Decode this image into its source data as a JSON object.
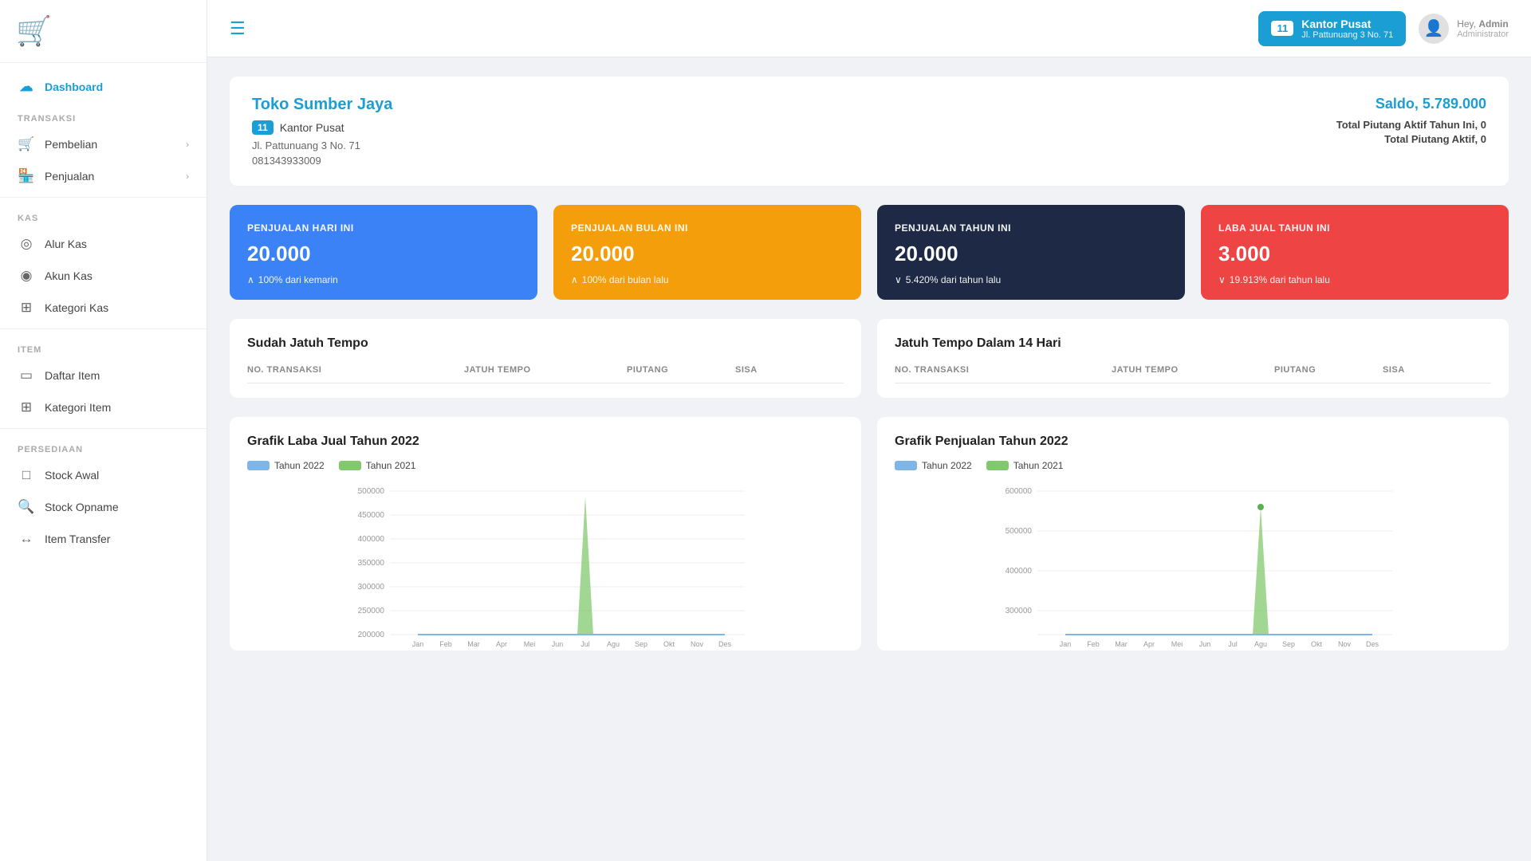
{
  "sidebar": {
    "logo_icon": "🛒",
    "nav_items": [
      {
        "id": "dashboard",
        "label": "Dashboard",
        "icon": "☁",
        "active": true,
        "section": null
      },
      {
        "id": "pembelian",
        "label": "Pembelian",
        "icon": "🛒",
        "active": false,
        "section": "TRANSAKSI",
        "has_chevron": true
      },
      {
        "id": "penjualan",
        "label": "Penjualan",
        "icon": "🏪",
        "active": false,
        "section": null,
        "has_chevron": true
      },
      {
        "id": "alur-kas",
        "label": "Alur Kas",
        "icon": "◎",
        "active": false,
        "section": "KAS"
      },
      {
        "id": "akun-kas",
        "label": "Akun Kas",
        "icon": "◉",
        "active": false,
        "section": null
      },
      {
        "id": "kategori-kas",
        "label": "Kategori Kas",
        "icon": "⊞",
        "active": false,
        "section": null
      },
      {
        "id": "daftar-item",
        "label": "Daftar Item",
        "icon": "▭",
        "active": false,
        "section": "ITEM"
      },
      {
        "id": "kategori-item",
        "label": "Kategori Item",
        "icon": "⊞",
        "active": false,
        "section": null
      },
      {
        "id": "stock-awal",
        "label": "Stock Awal",
        "icon": "□",
        "active": false,
        "section": "PERSEDIAAN"
      },
      {
        "id": "stock-opname",
        "label": "Stock Opname",
        "icon": "🔍",
        "active": false,
        "section": null
      },
      {
        "id": "item-transfer",
        "label": "Item Transfer",
        "icon": "↔",
        "active": false,
        "section": null
      }
    ]
  },
  "topbar": {
    "store_num": "11",
    "store_name": "Kantor Pusat",
    "store_addr": "Jl. Pattunuang 3 No. 71",
    "user_hey": "Hey,",
    "user_name": "Admin",
    "user_role": "Administrator"
  },
  "store_card": {
    "name": "Toko Sumber Jaya",
    "branch_num": "11",
    "branch_name": "Kantor Pusat",
    "address": "Jl. Pattunuang 3 No. 71",
    "phone": "081343933009",
    "saldo": "Saldo, 5.789.000",
    "piutang_aktif_tahun": "Total Piutang Aktif Tahun Ini,",
    "piutang_aktif_tahun_val": "0",
    "piutang_aktif": "Total Piutang Aktif,",
    "piutang_aktif_val": "0"
  },
  "stats": [
    {
      "label": "PENJUALAN HARI INI",
      "value": "20.000",
      "change": "100% dari kemarin",
      "direction": "up",
      "color": "blue"
    },
    {
      "label": "PENJUALAN BULAN INI",
      "value": "20.000",
      "change": "100% dari bulan lalu",
      "direction": "up",
      "color": "orange"
    },
    {
      "label": "PENJUALAN TAHUN INI",
      "value": "20.000",
      "change": "5.420% dari tahun lalu",
      "direction": "down",
      "color": "dark"
    },
    {
      "label": "LABA JUAL TAHUN INI",
      "value": "3.000",
      "change": "19.913% dari tahun lalu",
      "direction": "down",
      "color": "red"
    }
  ],
  "jatuh_tempo_left": {
    "title": "Sudah Jatuh Tempo",
    "columns": [
      "NO. TRANSAKSI",
      "JATUH TEMPO",
      "PIUTANG",
      "SISA"
    ],
    "rows": []
  },
  "jatuh_tempo_right": {
    "title": "Jatuh Tempo Dalam 14 Hari",
    "columns": [
      "NO. TRANSAKSI",
      "JATUH TEMPO",
      "PIUTANG",
      "SISA"
    ],
    "rows": []
  },
  "chart_left": {
    "title": "Grafik Laba Jual Tahun 2022",
    "legend": [
      {
        "label": "Tahun 2022",
        "color": "#7eb6e8"
      },
      {
        "label": "Tahun 2021",
        "color": "#82c96e"
      }
    ],
    "y_labels": [
      "500000",
      "450000",
      "400000",
      "350000",
      "300000",
      "250000",
      "200000"
    ],
    "data_2022": [
      0,
      0,
      0,
      0,
      0,
      0,
      480000,
      0,
      0,
      0,
      0,
      0
    ],
    "data_2021": [
      0,
      0,
      0,
      0,
      0,
      0,
      0,
      0,
      0,
      0,
      0,
      0
    ]
  },
  "chart_right": {
    "title": "Grafik Penjualan Tahun 2022",
    "legend": [
      {
        "label": "Tahun 2022",
        "color": "#7eb6e8"
      },
      {
        "label": "Tahun 2021",
        "color": "#82c96e"
      }
    ],
    "y_labels": [
      "600000",
      "500000",
      "400000",
      "300000"
    ],
    "data_2022": [
      0,
      0,
      0,
      0,
      0,
      0,
      0,
      550000,
      0,
      0,
      0,
      0
    ],
    "data_2021": [
      0,
      0,
      0,
      0,
      0,
      0,
      0,
      0,
      0,
      0,
      0,
      0
    ]
  }
}
